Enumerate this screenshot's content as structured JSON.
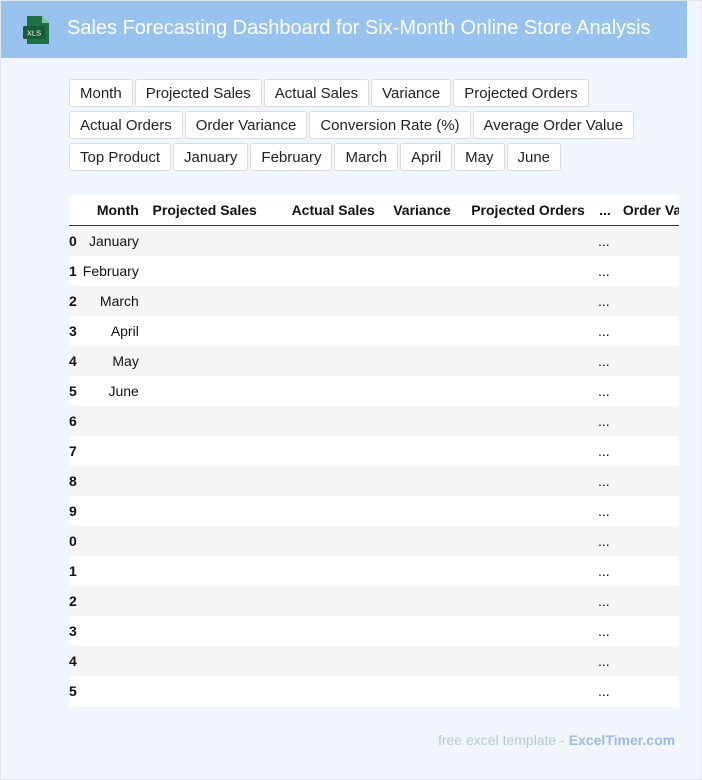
{
  "header": {
    "icon_label": "XLS",
    "title": "Sales Forecasting Dashboard for Six-Month Online Store Analysis"
  },
  "chips": [
    "Month",
    "Projected Sales",
    "Actual Sales",
    "Variance",
    "Projected Orders",
    "Actual Orders",
    "Order Variance",
    "Conversion Rate (%)",
    "Average Order Value",
    "Top Product",
    "January",
    "February",
    "March",
    "April",
    "May",
    "June"
  ],
  "table": {
    "columns": [
      "Month",
      "Projected Sales",
      "Actual Sales",
      "Variance",
      "Projected Orders",
      "...",
      "Order Varian"
    ],
    "rows": [
      {
        "index": "0",
        "month": "January"
      },
      {
        "index": "1",
        "month": "February"
      },
      {
        "index": "2",
        "month": "March"
      },
      {
        "index": "3",
        "month": "April"
      },
      {
        "index": "4",
        "month": "May"
      },
      {
        "index": "5",
        "month": "June"
      },
      {
        "index": "6",
        "month": ""
      },
      {
        "index": "7",
        "month": ""
      },
      {
        "index": "8",
        "month": ""
      },
      {
        "index": "9",
        "month": ""
      },
      {
        "index": "0",
        "month": ""
      },
      {
        "index": "1",
        "month": ""
      },
      {
        "index": "2",
        "month": ""
      },
      {
        "index": "3",
        "month": ""
      },
      {
        "index": "4",
        "month": ""
      },
      {
        "index": "5",
        "month": ""
      }
    ],
    "ellipsis": "..."
  },
  "footer": {
    "prefix": "free excel template - ",
    "brand": "ExcelTimer.com"
  },
  "colors": {
    "header_bg": "#98c3ee",
    "page_bg": "#f1f6fc",
    "icon_green": "#1e7145"
  }
}
